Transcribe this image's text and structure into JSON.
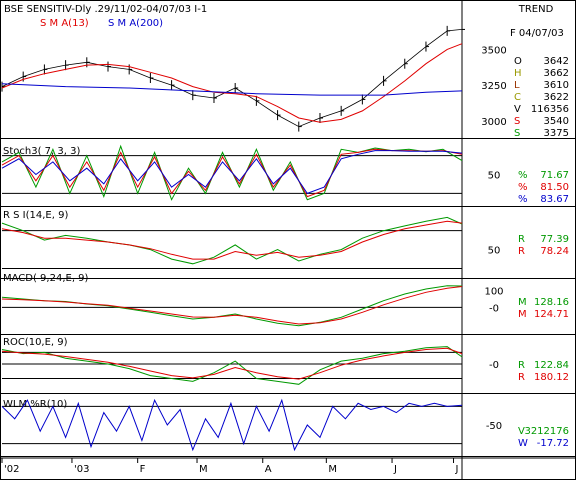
{
  "header": {
    "title": "BSE SENSITIV-Dly .29/11/02-04/07/03  I-1",
    "trend_label": "TREND",
    "sma_short_label": "S M A(13)",
    "sma_long_label": "S M A(200)"
  },
  "colors": {
    "price": "#000000",
    "sma_short": "#e00000",
    "sma_long": "#0000cc",
    "green_line": "#009900",
    "blue_line": "#0000cc",
    "red_line": "#e00000",
    "label_dark": "#000000",
    "label_olive": "#999900",
    "label_brown": "#993300"
  },
  "readouts": {
    "date": "F 04/07/03",
    "ohlc": [
      {
        "key": "O",
        "value": "3642",
        "color": "#000000"
      },
      {
        "key": "H",
        "value": "3662",
        "color": "#999900"
      },
      {
        "key": "L",
        "value": "3610",
        "color": "#993300"
      },
      {
        "key": "C",
        "value": "3622",
        "color": "#999900"
      },
      {
        "key": "V",
        "value": "116356",
        "color": "#000000"
      },
      {
        "key": "S",
        "value": "3540",
        "color": "#e00000"
      },
      {
        "key": "S",
        "value": "3375",
        "color": "#009900"
      }
    ],
    "stoch": [
      {
        "key": "%",
        "value": "71.67",
        "color": "#009900"
      },
      {
        "key": "%",
        "value": "81.50",
        "color": "#e00000"
      },
      {
        "key": "%",
        "value": "83.67",
        "color": "#0000cc"
      }
    ],
    "rsi": [
      {
        "key": "R",
        "value": "77.39",
        "color": "#009900"
      },
      {
        "key": "R",
        "value": "78.24",
        "color": "#e00000"
      }
    ],
    "macd": [
      {
        "key": "M",
        "value": "128.16",
        "color": "#009900"
      },
      {
        "key": "M",
        "value": "124.71",
        "color": "#e00000"
      }
    ],
    "roc": [
      {
        "key": "R",
        "value": "122.84",
        "color": "#009900"
      },
      {
        "key": "R",
        "value": "180.12",
        "color": "#e00000"
      }
    ],
    "wlm": [
      {
        "key": "V",
        "value": "3212176",
        "color": "#009900"
      },
      {
        "key": "W",
        "value": "-17.72",
        "color": "#0000cc"
      }
    ]
  },
  "chart_data": {
    "type": "line",
    "x_axis": {
      "tick_labels": [
        "'02",
        "'03",
        "F",
        "M",
        "A",
        "M",
        "J",
        "J"
      ],
      "tick_days": [
        0,
        33,
        64,
        92,
        123,
        153,
        184,
        213
      ],
      "range_days": [
        0,
        217
      ]
    },
    "panels": [
      {
        "id": "price",
        "label": "",
        "y_range": [
          2880,
          3720
        ],
        "y_ticks": [
          3000,
          3250,
          3500
        ],
        "y_tick_labels": [
          "3000",
          "3250",
          "3500"
        ],
        "hlines": [],
        "series": [
          {
            "name": "",
            "style": "bars",
            "color": "#000000",
            "x": [
              0,
              10,
              20,
              30,
              40,
              50,
              60,
              70,
              80,
              90,
              100,
              110,
              120,
              130,
              140,
              150,
              160,
              170,
              180,
              190,
              200,
              210,
              217
            ],
            "y": [
              3240,
              3310,
              3360,
              3390,
              3410,
              3380,
              3360,
              3300,
              3250,
              3180,
              3160,
              3230,
              3140,
              3040,
              2960,
              3020,
              3070,
              3150,
              3280,
              3400,
              3520,
              3630,
              3640
            ]
          },
          {
            "name": "S M A(13)",
            "color": "#e00000",
            "x": [
              0,
              10,
              20,
              30,
              40,
              50,
              60,
              70,
              80,
              90,
              100,
              110,
              120,
              130,
              140,
              150,
              160,
              170,
              180,
              190,
              200,
              210,
              217
            ],
            "y": [
              3230,
              3290,
              3330,
              3360,
              3390,
              3395,
              3380,
              3340,
              3300,
              3240,
              3200,
              3190,
              3170,
              3100,
              3020,
              2990,
              3010,
              3070,
              3170,
              3280,
              3400,
              3500,
              3540
            ]
          },
          {
            "name": "S M A(200)",
            "color": "#0000cc",
            "x": [
              0,
              30,
              60,
              90,
              120,
              150,
              180,
              200,
              217
            ],
            "y": [
              3260,
              3240,
              3230,
              3210,
              3190,
              3180,
              3180,
              3200,
              3210
            ]
          }
        ]
      },
      {
        "id": "stoch",
        "label": "Stoch3( 7, 3, 3)",
        "y_range": [
          0,
          100
        ],
        "y_ticks": [
          50
        ],
        "y_tick_labels": [
          "50"
        ],
        "hlines": [
          80,
          20
        ],
        "series": [
          {
            "name": "",
            "color": "#009900",
            "x": [
              0,
              8,
              16,
              24,
              32,
              40,
              48,
              56,
              64,
              72,
              80,
              88,
              96,
              104,
              112,
              120,
              128,
              136,
              144,
              152,
              160,
              168,
              176,
              184,
              192,
              200,
              208,
              217
            ],
            "y": [
              70,
              85,
              30,
              90,
              20,
              80,
              15,
              95,
              20,
              85,
              10,
              60,
              20,
              85,
              30,
              90,
              25,
              70,
              10,
              20,
              90,
              85,
              92,
              88,
              90,
              86,
              90,
              72
            ]
          },
          {
            "name": "",
            "color": "#e00000",
            "x": [
              0,
              8,
              16,
              24,
              32,
              40,
              48,
              56,
              64,
              72,
              80,
              88,
              96,
              104,
              112,
              120,
              128,
              136,
              144,
              152,
              160,
              168,
              176,
              184,
              192,
              200,
              208,
              217
            ],
            "y": [
              65,
              80,
              40,
              80,
              30,
              70,
              25,
              85,
              30,
              78,
              20,
              55,
              25,
              78,
              35,
              82,
              30,
              65,
              15,
              25,
              82,
              85,
              90,
              88,
              88,
              87,
              88,
              82
            ]
          },
          {
            "name": "",
            "color": "#0000cc",
            "x": [
              0,
              8,
              16,
              24,
              32,
              40,
              48,
              56,
              64,
              72,
              80,
              88,
              96,
              104,
              112,
              120,
              128,
              136,
              144,
              152,
              160,
              168,
              176,
              184,
              192,
              200,
              208,
              217
            ],
            "y": [
              60,
              75,
              50,
              70,
              40,
              60,
              35,
              75,
              40,
              70,
              30,
              50,
              30,
              70,
              40,
              75,
              35,
              60,
              20,
              30,
              75,
              82,
              88,
              88,
              87,
              87,
              87,
              84
            ]
          }
        ]
      },
      {
        "id": "rsi",
        "label": "R S I(14,E, 9)",
        "y_range": [
          20,
          95
        ],
        "y_ticks": [
          50
        ],
        "y_tick_labels": [
          "50"
        ],
        "hlines": [
          70,
          30
        ],
        "series": [
          {
            "name": "",
            "color": "#009900",
            "x": [
              0,
              10,
              20,
              30,
              40,
              50,
              60,
              70,
              80,
              90,
              100,
              110,
              120,
              130,
              140,
              150,
              160,
              170,
              180,
              190,
              200,
              210,
              217
            ],
            "y": [
              78,
              70,
              60,
              65,
              62,
              58,
              55,
              50,
              40,
              35,
              42,
              55,
              40,
              50,
              38,
              45,
              50,
              62,
              70,
              75,
              80,
              84,
              77
            ]
          },
          {
            "name": "",
            "color": "#e00000",
            "x": [
              0,
              10,
              20,
              30,
              40,
              50,
              60,
              70,
              80,
              90,
              100,
              110,
              120,
              130,
              140,
              150,
              160,
              170,
              180,
              190,
              200,
              210,
              217
            ],
            "y": [
              72,
              68,
              62,
              62,
              60,
              58,
              55,
              51,
              45,
              40,
              40,
              48,
              44,
              47,
              42,
              44,
              48,
              58,
              66,
              72,
              76,
              80,
              78
            ]
          }
        ]
      },
      {
        "id": "macd",
        "label": "MACD( 9,24,E, 9)",
        "y_range": [
          -160,
          170
        ],
        "y_ticks": [
          100,
          0
        ],
        "y_tick_labels": [
          "100",
          "-0"
        ],
        "hlines": [
          0
        ],
        "series": [
          {
            "name": "",
            "color": "#009900",
            "x": [
              0,
              10,
              20,
              30,
              40,
              50,
              60,
              70,
              80,
              90,
              100,
              110,
              120,
              130,
              140,
              150,
              160,
              170,
              180,
              190,
              200,
              210,
              217
            ],
            "y": [
              60,
              50,
              40,
              35,
              20,
              10,
              -10,
              -30,
              -50,
              -70,
              -60,
              -40,
              -70,
              -95,
              -110,
              -90,
              -60,
              -10,
              40,
              80,
              110,
              130,
              128
            ]
          },
          {
            "name": "",
            "color": "#e00000",
            "x": [
              0,
              10,
              20,
              30,
              40,
              50,
              60,
              70,
              80,
              90,
              100,
              110,
              120,
              130,
              140,
              150,
              160,
              170,
              180,
              190,
              200,
              210,
              217
            ],
            "y": [
              50,
              45,
              40,
              32,
              22,
              12,
              -5,
              -22,
              -40,
              -58,
              -60,
              -48,
              -60,
              -82,
              -100,
              -92,
              -70,
              -30,
              15,
              55,
              90,
              115,
              125
            ]
          }
        ]
      },
      {
        "id": "roc",
        "label": "ROC(10,E, 9)",
        "y_range": [
          -500,
          500
        ],
        "y_ticks": [
          0
        ],
        "y_tick_labels": [
          "-0"
        ],
        "hlines": [
          0,
          200,
          -250
        ],
        "series": [
          {
            "name": "",
            "color": "#009900",
            "x": [
              0,
              10,
              20,
              30,
              40,
              50,
              60,
              70,
              80,
              90,
              100,
              110,
              120,
              130,
              140,
              150,
              160,
              170,
              180,
              190,
              200,
              210,
              217
            ],
            "y": [
              250,
              180,
              200,
              100,
              50,
              0,
              -80,
              -200,
              -250,
              -300,
              -150,
              50,
              -250,
              -300,
              -350,
              -100,
              50,
              100,
              180,
              220,
              280,
              300,
              123
            ]
          },
          {
            "name": "",
            "color": "#e00000",
            "x": [
              0,
              10,
              20,
              30,
              40,
              50,
              60,
              70,
              80,
              90,
              100,
              110,
              120,
              130,
              140,
              150,
              160,
              170,
              180,
              190,
              200,
              210,
              217
            ],
            "y": [
              220,
              190,
              170,
              130,
              80,
              30,
              -40,
              -120,
              -200,
              -240,
              -180,
              -60,
              -150,
              -220,
              -260,
              -150,
              -20,
              70,
              140,
              200,
              250,
              270,
              180
            ]
          }
        ]
      },
      {
        "id": "wlm",
        "label": "WLM %R(10)",
        "y_range": [
          -100,
          0
        ],
        "y_ticks": [
          -50
        ],
        "y_tick_labels": [
          "-50"
        ],
        "hlines": [
          -20,
          -80
        ],
        "series": [
          {
            "name": "",
            "color": "#0000cc",
            "x": [
              0,
              6,
              12,
              18,
              24,
              30,
              36,
              42,
              48,
              54,
              60,
              66,
              72,
              78,
              84,
              90,
              96,
              102,
              108,
              114,
              120,
              126,
              132,
              138,
              144,
              150,
              156,
              162,
              168,
              174,
              180,
              186,
              192,
              198,
              204,
              210,
              217
            ],
            "y": [
              -20,
              -40,
              -10,
              -60,
              -20,
              -70,
              -15,
              -85,
              -30,
              -60,
              -20,
              -75,
              -10,
              -50,
              -25,
              -90,
              -40,
              -70,
              -15,
              -80,
              -20,
              -60,
              -10,
              -90,
              -50,
              -70,
              -20,
              -40,
              -15,
              -25,
              -20,
              -30,
              -15,
              -20,
              -15,
              -20,
              -18
            ]
          }
        ]
      }
    ]
  }
}
